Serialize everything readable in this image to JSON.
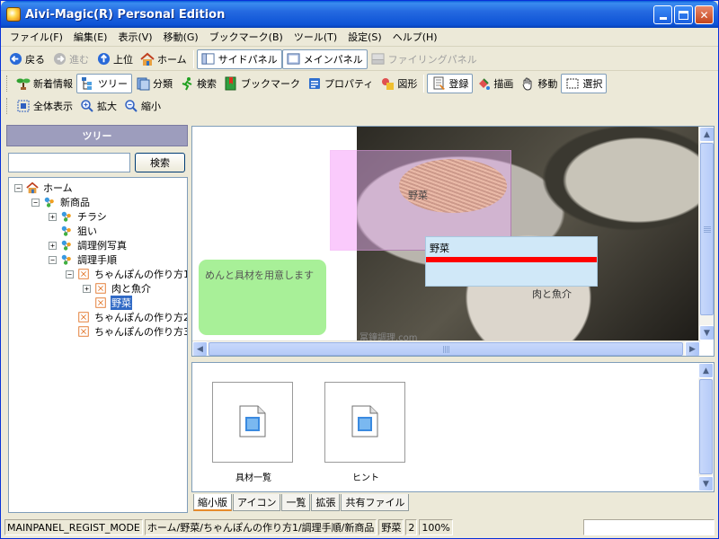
{
  "window": {
    "title": "Aivi-Magic(R) Personal Edition"
  },
  "menu": [
    "ファイル(F)",
    "編集(E)",
    "表示(V)",
    "移動(G)",
    "ブックマーク(B)",
    "ツール(T)",
    "設定(S)",
    "ヘルプ(H)"
  ],
  "nav_toolbar": {
    "back": "戻る",
    "forward": "進む",
    "up": "上位",
    "home": "ホーム",
    "side_panel": "サイドパネル",
    "main_panel": "メインパネル",
    "filing_panel": "ファイリングパネル"
  },
  "view_toolbar": {
    "new_info": "新着情報",
    "tree": "ツリー",
    "classify": "分類",
    "search": "検索",
    "bookmark": "ブックマーク",
    "property": "プロパティ",
    "figure": "図形",
    "register": "登録",
    "draw": "描画",
    "move": "移動",
    "select": "選択"
  },
  "zoom_toolbar": {
    "fit": "全体表示",
    "zoom_in": "拡大",
    "zoom_out": "縮小"
  },
  "side_panel": {
    "header": "ツリー",
    "search_placeholder": "",
    "search_button": "検索",
    "tree": [
      {
        "label": "ホーム",
        "depth": 0,
        "expander": "−",
        "icon": "home-icon"
      },
      {
        "label": "新商品",
        "depth": 1,
        "expander": "−",
        "icon": "molecule-icon"
      },
      {
        "label": "チラシ",
        "depth": 2,
        "expander": "+",
        "icon": "molecule-icon"
      },
      {
        "label": "狙い",
        "depth": 2,
        "expander": "",
        "icon": "molecule-icon"
      },
      {
        "label": "調理例写真",
        "depth": 2,
        "expander": "+",
        "icon": "molecule-icon"
      },
      {
        "label": "調理手順",
        "depth": 2,
        "expander": "−",
        "icon": "molecule-icon"
      },
      {
        "label": "ちゃんぽんの作り方1",
        "depth": 3,
        "expander": "−",
        "icon": "page-icon"
      },
      {
        "label": "肉と魚介",
        "depth": 4,
        "expander": "+",
        "icon": "page-icon"
      },
      {
        "label": "野菜",
        "depth": 4,
        "expander": "",
        "icon": "page-icon",
        "selected": true
      },
      {
        "label": "ちゃんぽんの作り方2",
        "depth": 3,
        "expander": "",
        "icon": "page-icon"
      },
      {
        "label": "ちゃんぽんの作り方3",
        "depth": 3,
        "expander": "",
        "icon": "page-icon"
      }
    ]
  },
  "canvas": {
    "region_label": "野菜",
    "popup_title": "野菜",
    "note_text": "めんと具材を用意します",
    "meat_label": "肉と魚介",
    "watermark": "冨鐘調理.com"
  },
  "files": [
    {
      "name": "具材一覧"
    },
    {
      "name": "ヒント"
    }
  ],
  "tabs": [
    "縮小版",
    "アイコン",
    "一覧",
    "拡張",
    "共有ファイル"
  ],
  "status": {
    "mode": "MAINPANEL_REGIST_MODE",
    "path": "ホーム/野菜/ちゃんぽんの作り方1/調理手順/新商品",
    "node": "野菜",
    "count": "2",
    "zoom": "100%"
  },
  "colors": {
    "title_bar": "#0d53d6",
    "selection": "#316ac5",
    "popup_bar": "#ff0000",
    "note_bg": "#a8f098",
    "region_overlay": "#f0b4fa"
  }
}
